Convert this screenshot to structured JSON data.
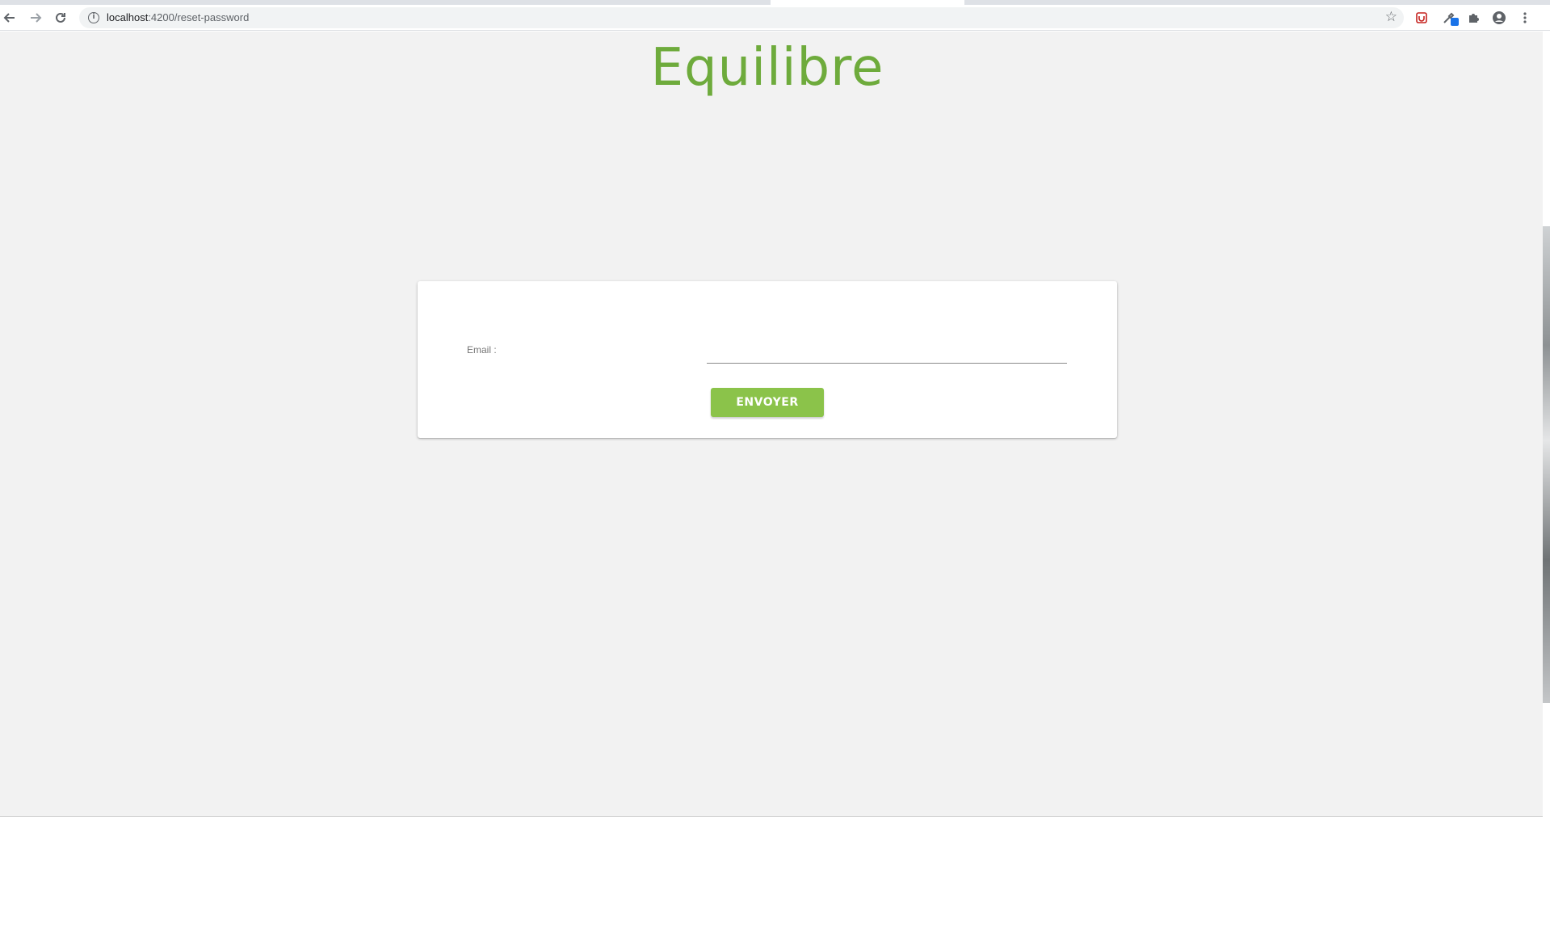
{
  "browser": {
    "url_host": "localhost",
    "url_path": ":4200/reset-password",
    "icons": {
      "back": "arrow-left-icon",
      "forward": "arrow-right-icon",
      "reload": "reload-icon",
      "info": "info-icon",
      "bookmark": "star-icon",
      "extensions": [
        "shield-extension-icon",
        "eyedropper-extension-icon",
        "puzzle-icon",
        "account-icon",
        "menu-icon"
      ]
    }
  },
  "page": {
    "brand": "Equilibre",
    "brand_color": "#6eab3c",
    "form": {
      "email_label": "Email :",
      "email_value": "",
      "submit_label": "ENVOYER",
      "submit_color": "#8bc34a"
    }
  }
}
